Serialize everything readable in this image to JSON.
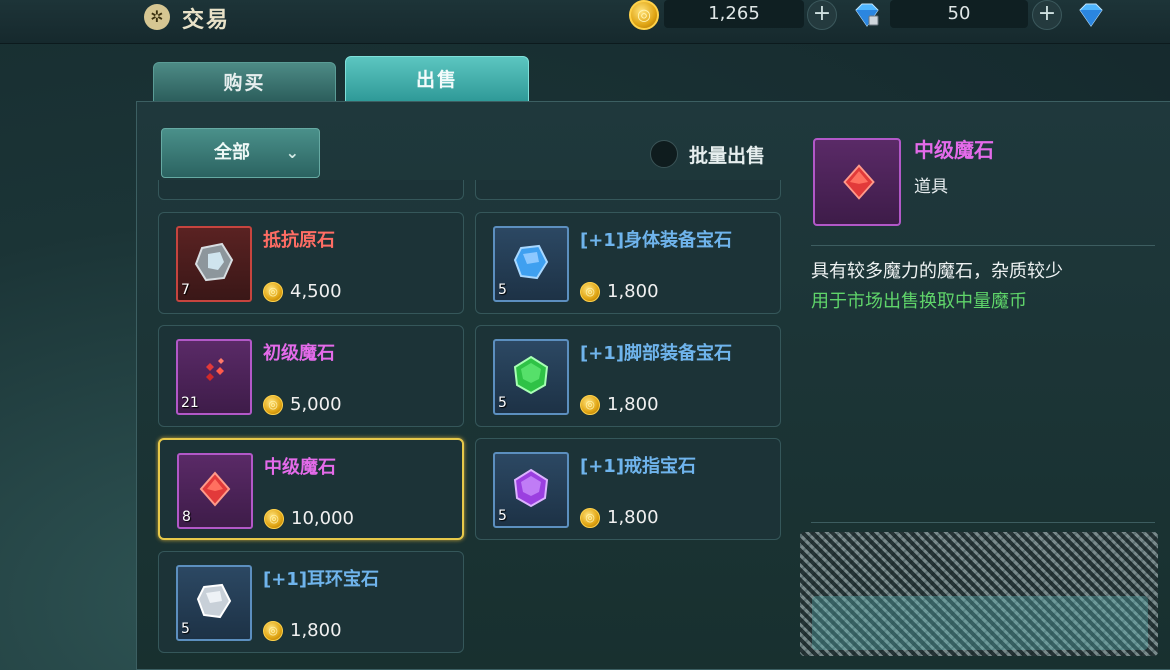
{
  "header": {
    "title": "交易",
    "title_icon": "settings-emblem-icon",
    "gold_amount": "1,265",
    "diamond_bound_amount": "50",
    "plus_label": "+"
  },
  "tabs": [
    {
      "label": "购买",
      "active": false
    },
    {
      "label": "出售",
      "active": true
    }
  ],
  "filter": {
    "label": "全部",
    "chevron": "⌄"
  },
  "batch_sell": {
    "label": "批量出售",
    "checked": false
  },
  "items": [
    {
      "name": "抵抗原石",
      "qty": "7",
      "price": "4,500",
      "rarity": "red",
      "gem_color": "#cfe4ee",
      "icon": "resistance-ore-icon"
    },
    {
      "name": "[+1]身体装备宝石",
      "qty": "5",
      "price": "1,800",
      "rarity": "blue",
      "gem_color": "#3fa0f0",
      "icon": "blue-gem-icon"
    },
    {
      "name": "初级魔石",
      "qty": "21",
      "price": "5,000",
      "rarity": "purple",
      "gem_color": "#e23a3a",
      "icon": "small-magic-stones-icon"
    },
    {
      "name": "[+1]脚部装备宝石",
      "qty": "5",
      "price": "1,800",
      "rarity": "blue",
      "gem_color": "#33c94a",
      "icon": "green-gem-icon"
    },
    {
      "name": "中级魔石",
      "qty": "8",
      "price": "10,000",
      "rarity": "purple",
      "gem_color": "#e23a3a",
      "icon": "red-gem-icon",
      "selected": true
    },
    {
      "name": "[+1]戒指宝石",
      "qty": "5",
      "price": "1,800",
      "rarity": "blue",
      "gem_color": "#a44ee8",
      "icon": "purple-gem-icon"
    },
    {
      "name": "[+1]耳环宝石",
      "qty": "5",
      "price": "1,800",
      "rarity": "blue",
      "gem_color": "#dfe4ea",
      "icon": "white-gem-icon"
    }
  ],
  "detail": {
    "name": "中级魔石",
    "type": "道具",
    "description": "具有较多魔力的魔石，杂质较少",
    "usage": "用于市场出售换取中量魔币"
  },
  "colors": {
    "rarity_red": "#c6443e",
    "rarity_purple": "#b258c8",
    "rarity_blue": "#5c8fbf",
    "selected_border": "#e7c94a",
    "usage_text": "#5fd46a",
    "tab_active": "#3fb0ac"
  }
}
